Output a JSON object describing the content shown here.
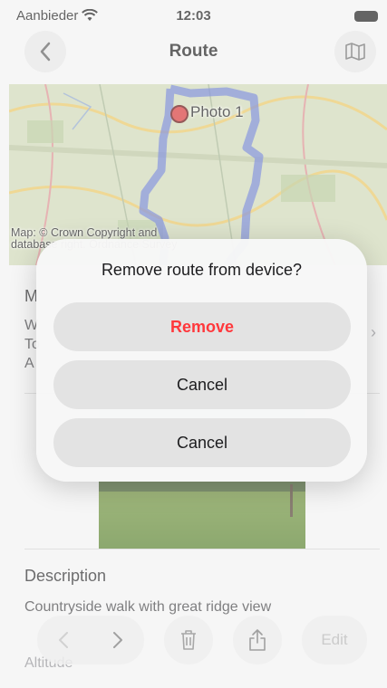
{
  "status_bar": {
    "carrier": "Aanbieder",
    "time": "12:03"
  },
  "nav": {
    "title": "Route"
  },
  "map": {
    "photo_label": "Photo 1",
    "copyright": "Map: © Crown Copyright and database right. Ordnance Survey"
  },
  "content": {
    "section_title": "M",
    "info_lines": [
      "W",
      "To",
      "A"
    ],
    "description_title": "Description",
    "description_text": "Countryside walk with great ridge view",
    "altitude_label": "Altitude"
  },
  "toolbar": {
    "edit_label": "Edit"
  },
  "alert": {
    "title": "Remove route from device?",
    "buttons": [
      "Remove",
      "Cancel",
      "Cancel"
    ]
  },
  "colors": {
    "destructive": "#ff383c",
    "route": "#4a5fd0"
  }
}
